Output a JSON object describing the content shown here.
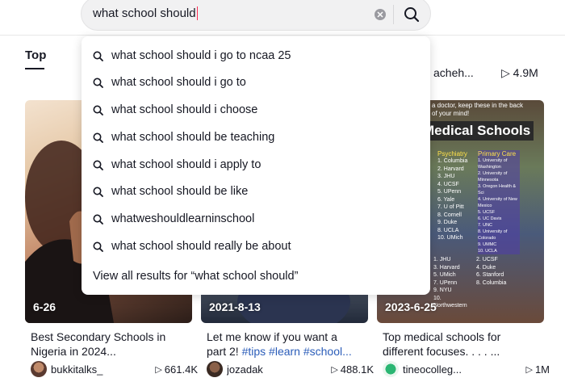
{
  "search": {
    "query": "what school should"
  },
  "tabs": [
    {
      "label": "Top"
    }
  ],
  "behind": {
    "text": "acheh...",
    "views": "4.9M"
  },
  "dropdown": {
    "suggestions": [
      "what school should i go to ncaa 25",
      "what school should i go to",
      "what school should i choose",
      "what school should be teaching",
      "what school should i apply to",
      "what school should be like",
      "whatweshouldlearninschool",
      "what school should really be about"
    ],
    "view_all": "View all results for “what school should”"
  },
  "videos": [
    {
      "date": "6-26",
      "desc_line1": "Best Secondary Schools in",
      "desc_line2": "Nigeria in 2024...",
      "username": "bukkitalks_",
      "views": "661.4K"
    },
    {
      "date": "2021-8-13",
      "desc_line1": "Let me know if you want a",
      "desc_line2_text": "part 2! ",
      "desc_tags": "#tips #learn #school...",
      "username": "jozadak",
      "views": "488.1K"
    },
    {
      "date": "2023-6-25",
      "desc_line1": "Top medical schools for",
      "desc_line2": "different focuses. . . . ...",
      "username": "tineocolleg...",
      "views": "1M"
    }
  ],
  "medical_card": {
    "top_note": "a doctor, keep these in the back of your mind!",
    "title": "Medical Schools",
    "psychiatry_title": "Psychiatry",
    "psychiatry": [
      "1. Columbia",
      "2. Harvard",
      "3. JHU",
      "4. UCSF",
      "5. UPenn",
      "6. Yale",
      "7. U of Pitt",
      "8. Cornell",
      "9. Duke",
      "8. UCLA",
      "10. UMich"
    ],
    "primary_title": "Primary Care",
    "primary": [
      "1. University of Washington",
      "2. University of Minnesota",
      "3. Oregon Health & Sci",
      "4. University of New Mexico",
      "5. UCSF",
      "6. UC Davis",
      "7. UNC",
      "8. University of Colorado",
      "9. UMMC",
      "10. UCLA"
    ],
    "bottom_left": [
      "1. JHU",
      "3. Harvard",
      "5. UMich",
      "7. UPenn",
      "9. NYU",
      "10. Northwestern"
    ],
    "bottom_right": [
      "2. UCSF",
      "4. Duke",
      "6. Stanford",
      "8. Columbia"
    ]
  },
  "colors": {
    "accent_caret": "#fe2c55",
    "hashtag": "#2b5db9",
    "text": "#161823"
  }
}
